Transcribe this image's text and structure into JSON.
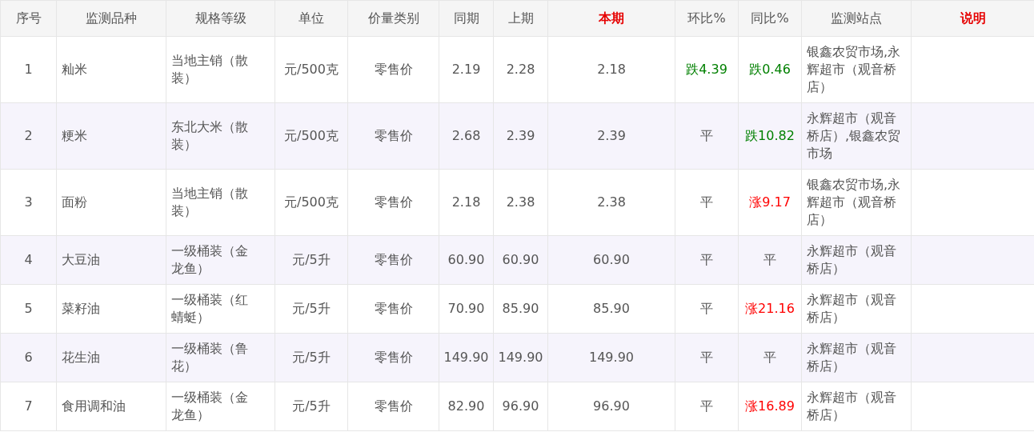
{
  "table": {
    "columns": [
      {
        "label": "序号",
        "highlight": false
      },
      {
        "label": "监测品种",
        "highlight": false
      },
      {
        "label": "规格等级",
        "highlight": false
      },
      {
        "label": "单位",
        "highlight": false
      },
      {
        "label": "价量类别",
        "highlight": false
      },
      {
        "label": "同期",
        "highlight": false
      },
      {
        "label": "上期",
        "highlight": false
      },
      {
        "label": "本期",
        "highlight": true
      },
      {
        "label": "环比%",
        "highlight": false
      },
      {
        "label": "同比%",
        "highlight": false
      },
      {
        "label": "监测站点",
        "highlight": false
      },
      {
        "label": "说明",
        "highlight": true
      }
    ],
    "rows": [
      {
        "cells": [
          "1",
          "籼米",
          "当地主销（散装）",
          "元/500克",
          "零售价",
          "2.19",
          "2.28",
          "2.18"
        ],
        "mom": {
          "text": "跌4.39",
          "kind": "down"
        },
        "yoy": {
          "text": "跌0.46",
          "kind": "down"
        },
        "site": "银鑫农贸市场,永辉超市（观音桥店）"
      },
      {
        "cells": [
          "2",
          "粳米",
          "东北大米（散装）",
          "元/500克",
          "零售价",
          "2.68",
          "2.39",
          "2.39"
        ],
        "mom": {
          "text": "平",
          "kind": "flat"
        },
        "yoy": {
          "text": "跌10.82",
          "kind": "down"
        },
        "site": "永辉超市（观音桥店）,银鑫农贸市场"
      },
      {
        "cells": [
          "3",
          "面粉",
          "当地主销（散装）",
          "元/500克",
          "零售价",
          "2.18",
          "2.38",
          "2.38"
        ],
        "mom": {
          "text": "平",
          "kind": "flat"
        },
        "yoy": {
          "text": "涨9.17",
          "kind": "up"
        },
        "site": "银鑫农贸市场,永辉超市（观音桥店）"
      },
      {
        "cells": [
          "4",
          "大豆油",
          "一级桶装（金龙鱼）",
          "元/5升",
          "零售价",
          "60.90",
          "60.90",
          "60.90"
        ],
        "mom": {
          "text": "平",
          "kind": "flat"
        },
        "yoy": {
          "text": "平",
          "kind": "flat"
        },
        "site": "永辉超市（观音桥店）"
      },
      {
        "cells": [
          "5",
          "菜籽油",
          "一级桶装（红蜻蜓）",
          "元/5升",
          "零售价",
          "70.90",
          "85.90",
          "85.90"
        ],
        "mom": {
          "text": "平",
          "kind": "flat"
        },
        "yoy": {
          "text": "涨21.16",
          "kind": "up"
        },
        "site": "永辉超市（观音桥店）"
      },
      {
        "cells": [
          "6",
          "花生油",
          "一级桶装（鲁花）",
          "元/5升",
          "零售价",
          "149.90",
          "149.90",
          "149.90"
        ],
        "mom": {
          "text": "平",
          "kind": "flat"
        },
        "yoy": {
          "text": "平",
          "kind": "flat"
        },
        "site": "永辉超市（观音桥店）"
      },
      {
        "cells": [
          "7",
          "食用调和油",
          "一级桶装（金龙鱼）",
          "元/5升",
          "零售价",
          "82.90",
          "96.90",
          "96.90"
        ],
        "mom": {
          "text": "平",
          "kind": "flat"
        },
        "yoy": {
          "text": "涨16.89",
          "kind": "up"
        },
        "site": "永辉超市（观音桥店）"
      }
    ]
  }
}
